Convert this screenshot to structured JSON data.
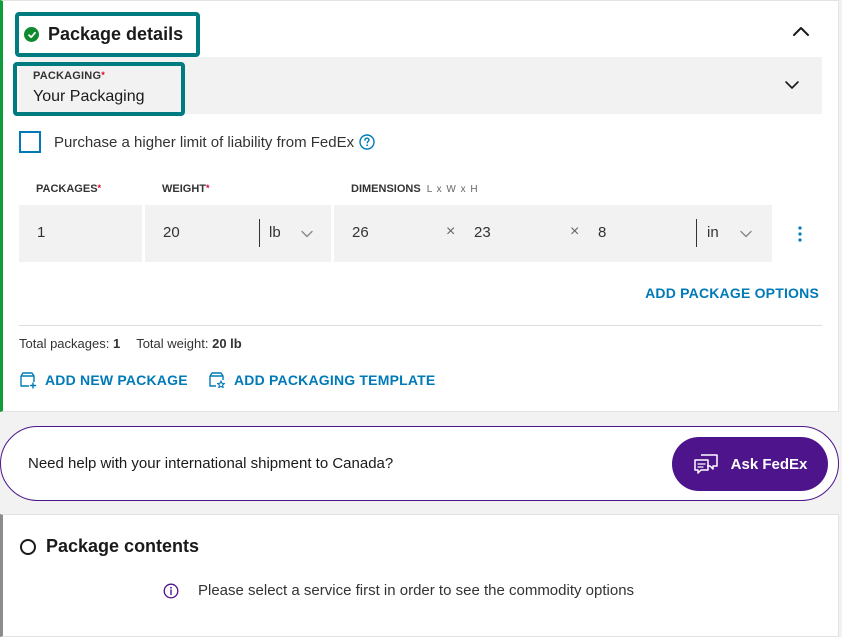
{
  "package_details": {
    "title": "Package details",
    "packaging": {
      "label": "PACKAGING",
      "required_mark": "*",
      "value": "Your Packaging"
    },
    "liability": {
      "label": "Purchase a higher limit of liability from FedEx",
      "checked": false
    },
    "columns": {
      "packages": "PACKAGES",
      "weight": "WEIGHT",
      "dimensions": "DIMENSIONS",
      "dimensions_hint": "L x W x H",
      "required_mark": "*"
    },
    "row": {
      "packages": "1",
      "weight": "20",
      "weight_unit": "lb",
      "length": "26",
      "width": "23",
      "height": "8",
      "dimension_unit": "in",
      "times": "×"
    },
    "add_package_options": "ADD PACKAGE OPTIONS",
    "totals": {
      "packages_label": "Total packages:",
      "packages_value": "1",
      "weight_label": "Total weight:",
      "weight_value": "20 lb"
    },
    "add_new_package": "ADD NEW PACKAGE",
    "add_packaging_template": "ADD PACKAGING TEMPLATE"
  },
  "help_banner": {
    "text": "Need help with your international shipment to Canada?",
    "button": "Ask FedEx"
  },
  "package_contents": {
    "title": "Package contents",
    "info": "Please select a service first in order to see the commodity options"
  },
  "colors": {
    "teal_highlight": "#007c80",
    "success_green": "#0f8a2f",
    "link_blue": "#007ab7",
    "fedex_purple": "#4d148c",
    "required_red": "#de002e"
  }
}
